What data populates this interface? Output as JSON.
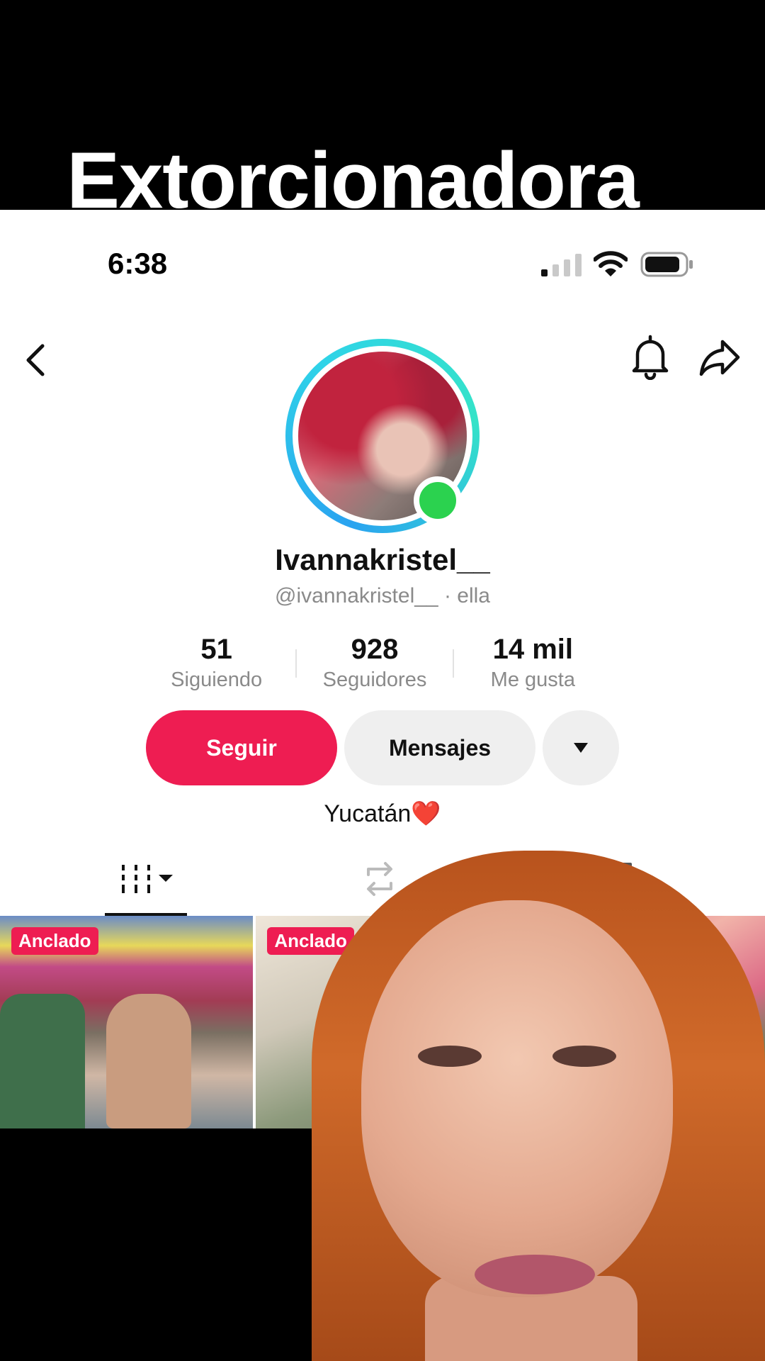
{
  "caption": {
    "text": "Extorcionadora"
  },
  "status_bar": {
    "time": "6:38"
  },
  "profile": {
    "display_name": "Ivannakristel__",
    "handle": "@ivannakristel__",
    "pronoun": " · ella",
    "stats": [
      {
        "value": "51",
        "label": "Siguiendo"
      },
      {
        "value": "928",
        "label": "Seguidores"
      },
      {
        "value": "14 mil",
        "label": "Me gusta"
      }
    ],
    "buttons": {
      "follow": "Seguir",
      "message": "Mensajes"
    },
    "bio": "Yucatán",
    "bio_emoji": "❤️"
  },
  "tabs": [
    "videos-grid-icon",
    "repost-icon",
    "bookmark-icon"
  ],
  "videos": [
    {
      "badge": "Anclado"
    },
    {
      "badge": "Anclado"
    },
    {
      "badge": ""
    }
  ],
  "colors": {
    "accent": "#ee1d52",
    "online": "#2bd24f"
  }
}
